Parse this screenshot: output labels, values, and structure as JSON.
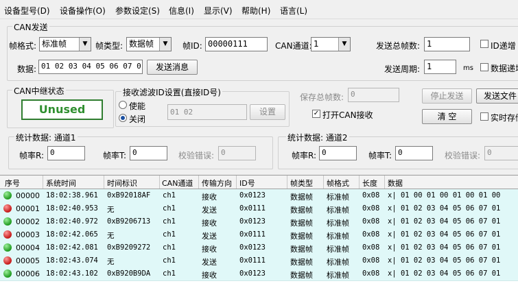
{
  "menu": [
    "设备型号(D)",
    "设备操作(O)",
    "参数设定(S)",
    "信息(I)",
    "显示(V)",
    "帮助(H)",
    "语言(L)"
  ],
  "can_send": {
    "title": "CAN发送",
    "frame_format_label": "帧格式:",
    "frame_format_value": "标准帧",
    "frame_type_label": "帧类型:",
    "frame_type_value": "数据帧",
    "frame_id_label": "帧ID:",
    "frame_id_value": "00000111",
    "channel_label": "CAN通道:",
    "channel_value": "1",
    "total_frames_label": "发送总帧数:",
    "total_frames_value": "1",
    "id_increment_label": "ID递增",
    "data_label": "数据:",
    "data_value": "01 02 03 04 05 06 07 01",
    "send_button": "发送消息",
    "period_label": "发送周期:",
    "period_value": "1",
    "period_unit": "ms",
    "data_increment_label": "数据递增"
  },
  "relay": {
    "title": "CAN中继状态",
    "status": "Unused"
  },
  "filter": {
    "title": "接收滤波ID设置(直接ID号)",
    "enable_label": "使能",
    "disable_label": "关闭",
    "selected": "关闭",
    "id_value": "01 02",
    "set_button": "设置"
  },
  "save": {
    "saved_frames_label": "保存总帧数:",
    "saved_frames_value": "0",
    "open_receive_label": "打开CAN接收",
    "open_receive_checked": true,
    "stop_send_button": "停止发送",
    "send_file_button": "发送文件",
    "clear_button": "清 空",
    "realtime_save_label": "实时存储"
  },
  "stats1": {
    "title": "统计数据: 通道1",
    "rate_r_label": "帧率R:",
    "rate_r_value": "0",
    "rate_t_label": "帧率T:",
    "rate_t_value": "0",
    "check_error_label": "校验错误:",
    "check_error_value": "0"
  },
  "stats2": {
    "title": "统计数据: 通道2",
    "rate_r_label": "帧率R:",
    "rate_r_value": "0",
    "rate_t_label": "帧率T:",
    "rate_t_value": "0",
    "check_error_label": "校验错误:",
    "check_error_value": "0"
  },
  "table": {
    "headers": [
      "序号",
      "系统时间",
      "时间标识",
      "CAN通道",
      "传输方向",
      "ID号",
      "帧类型",
      "帧格式",
      "长度",
      "数据"
    ],
    "rows": [
      {
        "status": "green",
        "seq": "00000",
        "time": "18:02:38.961",
        "stamp": "0xB92018AF",
        "channel": "ch1",
        "dir": "接收",
        "id": "0x0123",
        "type": "数据帧",
        "format": "标准帧",
        "len": "0x08",
        "data": "x| 01 00 01 00 01 00 01 00"
      },
      {
        "status": "red",
        "seq": "00001",
        "time": "18:02:40.953",
        "stamp": "无",
        "channel": "ch1",
        "dir": "发送",
        "id": "0x0111",
        "type": "数据帧",
        "format": "标准帧",
        "len": "0x08",
        "data": "x| 01 02 03 04 05 06 07 01"
      },
      {
        "status": "green",
        "seq": "00002",
        "time": "18:02:40.972",
        "stamp": "0xB9206713",
        "channel": "ch1",
        "dir": "接收",
        "id": "0x0123",
        "type": "数据帧",
        "format": "标准帧",
        "len": "0x08",
        "data": "x| 01 02 03 04 05 06 07 01"
      },
      {
        "status": "red",
        "seq": "00003",
        "time": "18:02:42.065",
        "stamp": "无",
        "channel": "ch1",
        "dir": "发送",
        "id": "0x0111",
        "type": "数据帧",
        "format": "标准帧",
        "len": "0x08",
        "data": "x| 01 02 03 04 05 06 07 01"
      },
      {
        "status": "green",
        "seq": "00004",
        "time": "18:02:42.081",
        "stamp": "0xB9209272",
        "channel": "ch1",
        "dir": "接收",
        "id": "0x0123",
        "type": "数据帧",
        "format": "标准帧",
        "len": "0x08",
        "data": "x| 01 02 03 04 05 06 07 01"
      },
      {
        "status": "red",
        "seq": "00005",
        "time": "18:02:43.074",
        "stamp": "无",
        "channel": "ch1",
        "dir": "发送",
        "id": "0x0111",
        "type": "数据帧",
        "format": "标准帧",
        "len": "0x08",
        "data": "x| 01 02 03 04 05 06 07 01"
      },
      {
        "status": "green",
        "seq": "00006",
        "time": "18:02:43.102",
        "stamp": "0xB920B9DA",
        "channel": "ch1",
        "dir": "接收",
        "id": "0x0123",
        "type": "数据帧",
        "format": "标准帧",
        "len": "0x08",
        "data": "x| 01 02 03 04 05 06 07 01"
      }
    ]
  }
}
